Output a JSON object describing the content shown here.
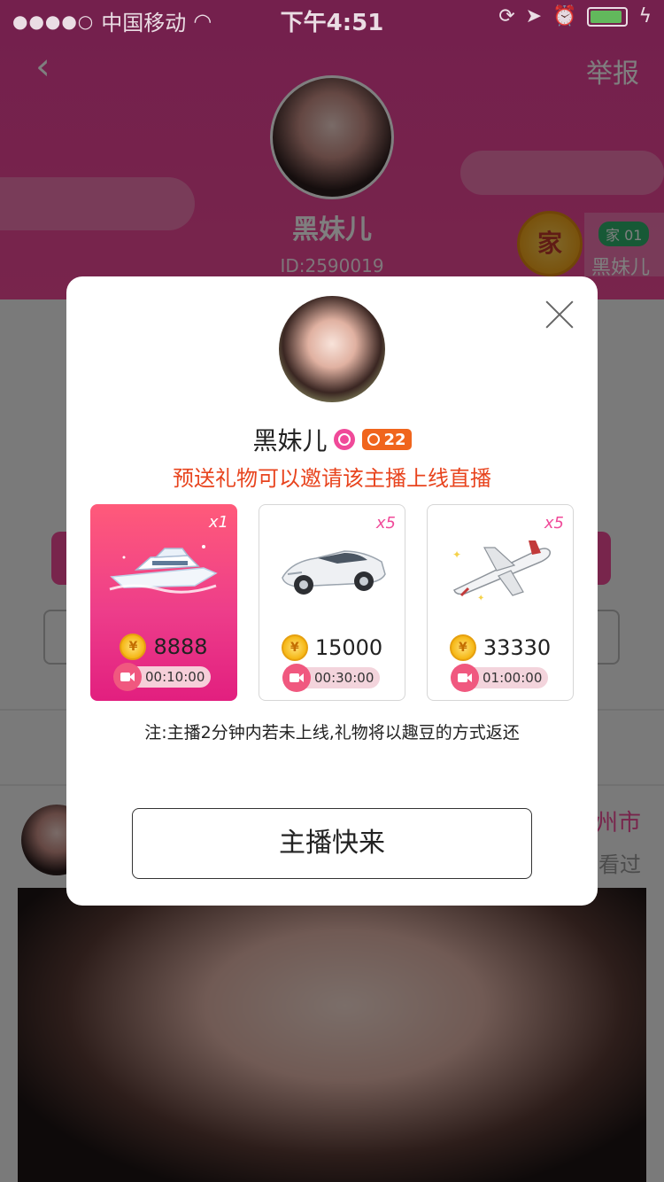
{
  "status_bar": {
    "carrier": "中国移动",
    "time": "下午4:51",
    "signal": "●●●●○",
    "battery_color": "#5fd35f"
  },
  "profile": {
    "report_label": "举报",
    "name": "黑妹儿",
    "id_text": "ID:2590019",
    "family_badge": "家",
    "family_tag": "家 01",
    "family_name": "黑妹儿"
  },
  "background_post": {
    "city": "州市",
    "seen": "看过"
  },
  "modal": {
    "name": "黑妹儿",
    "level": "22",
    "invite_text": "预送礼物可以邀请该主播上线直播",
    "gifts": [
      {
        "multiplier": "x1",
        "price": "8888",
        "duration": "00:10:00",
        "selected": true,
        "image": "yacht"
      },
      {
        "multiplier": "x5",
        "price": "15000",
        "duration": "00:30:00",
        "selected": false,
        "image": "sports-car"
      },
      {
        "multiplier": "x5",
        "price": "33330",
        "duration": "01:00:00",
        "selected": false,
        "image": "jet"
      }
    ],
    "note": "注:主播2分钟内若未上线,礼物将以趣豆的方式返还",
    "primary_button": "主播快来"
  },
  "colors": {
    "brand_pink": "#f04a99",
    "invite_red": "#e8441e",
    "level_orange": "#f0651d"
  }
}
